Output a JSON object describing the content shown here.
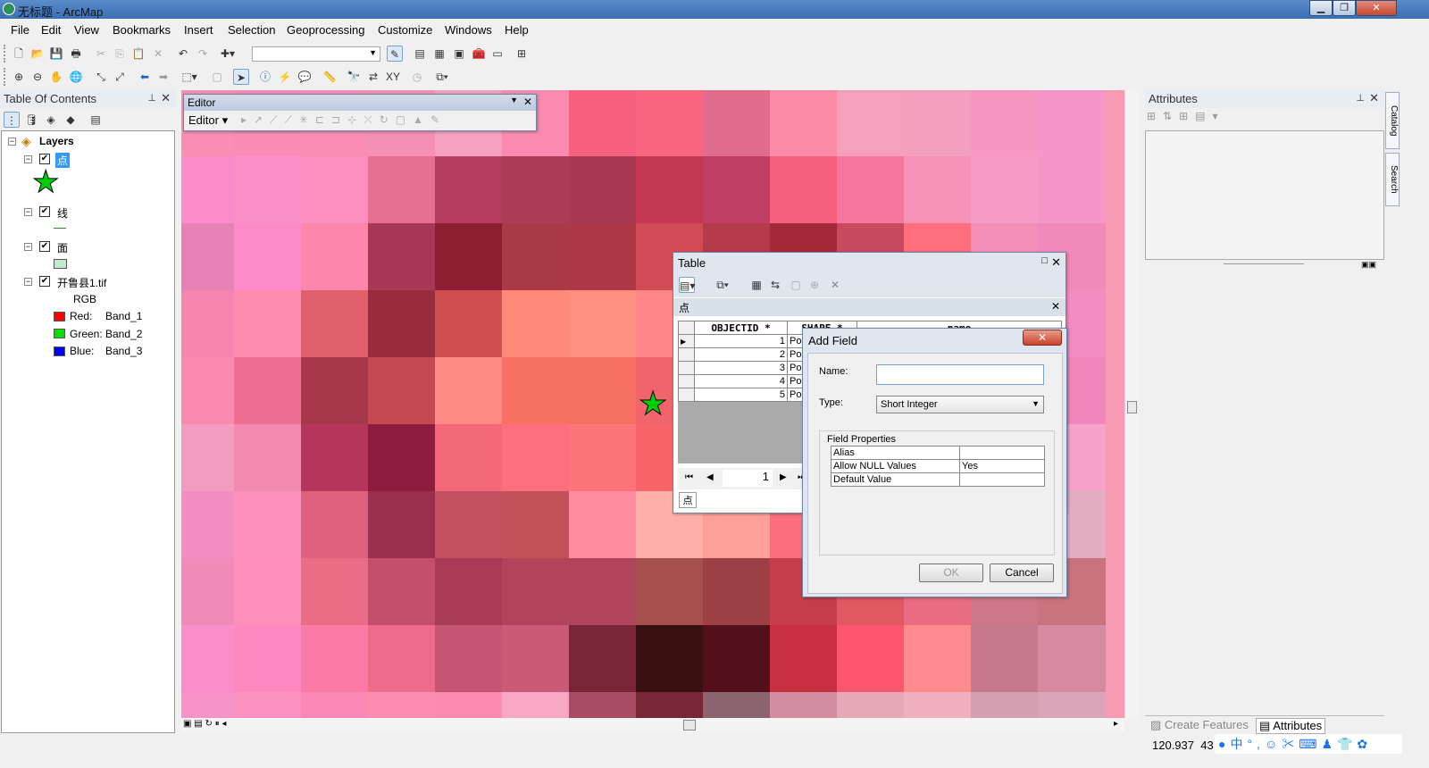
{
  "window": {
    "title": "无标题 - ArcMap",
    "min": "▁",
    "max": "❐",
    "close": "✕"
  },
  "menu": [
    "File",
    "Edit",
    "View",
    "Bookmarks",
    "Insert",
    "Selection",
    "Geoprocessing",
    "Customize",
    "Windows",
    "Help"
  ],
  "toc": {
    "title": "Table Of Contents",
    "root": "Layers",
    "layers": [
      {
        "name": "点",
        "checked": "✔"
      },
      {
        "name": "线",
        "checked": "✔"
      },
      {
        "name": "面",
        "checked": "✔"
      },
      {
        "name": "开鲁县1.tif",
        "checked": "✔"
      }
    ],
    "rgb_label": "RGB",
    "bands": [
      {
        "label": "Red:",
        "band": "Band_1",
        "color": "#ff0000"
      },
      {
        "label": "Green:",
        "band": "Band_2",
        "color": "#00e000"
      },
      {
        "label": "Blue:",
        "band": "Band_3",
        "color": "#0000ff"
      }
    ]
  },
  "editor": {
    "title": "Editor",
    "menu_label": "Editor ▾"
  },
  "attributes": {
    "title": "Attributes",
    "tabs": [
      "Create Features",
      "Attributes"
    ]
  },
  "side_tabs": [
    "Catalog",
    "Search"
  ],
  "table": {
    "title": "Table",
    "layer_tab": "点",
    "columns": [
      "OBJECTID *",
      "SHAPE *",
      "name"
    ],
    "rows": [
      {
        "id": "1",
        "shape": "Po"
      },
      {
        "id": "2",
        "shape": "Po"
      },
      {
        "id": "3",
        "shape": "Po"
      },
      {
        "id": "4",
        "shape": "Po"
      },
      {
        "id": "5",
        "shape": "Po"
      }
    ],
    "current_record": "1",
    "bottom_tab": "点"
  },
  "add_field": {
    "title": "Add Field",
    "name_label": "Name:",
    "name_value": "",
    "type_label": "Type:",
    "type_value": "Short Integer",
    "props_label": "Field Properties",
    "props": [
      {
        "k": "Alias",
        "v": ""
      },
      {
        "k": "Allow NULL Values",
        "v": "Yes"
      },
      {
        "k": "Default Value",
        "v": ""
      }
    ],
    "ok": "OK",
    "cancel": "Cancel"
  },
  "status": {
    "coords": "120.937  43"
  }
}
